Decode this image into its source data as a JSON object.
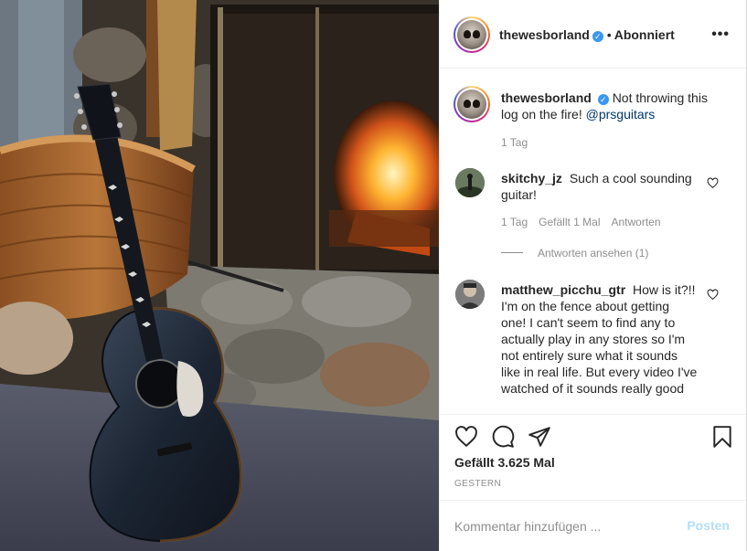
{
  "post": {
    "author": "thewesborland",
    "follow_status": "Abonniert",
    "separator": "•",
    "more_glyph": "•••",
    "verified_glyph": "✓"
  },
  "caption": {
    "username": "thewesborland",
    "text": "Not throwing this log on the fire!",
    "mention": "@prsguitars",
    "time": "1 Tag"
  },
  "comments": [
    {
      "username": "skitchy_jz",
      "text": "Such a cool sounding guitar!",
      "time": "1 Tag",
      "likes": "Gefällt 1 Mal",
      "reply": "Antworten",
      "view_replies": "Antworten ansehen (1)"
    },
    {
      "username": "matthew_picchu_gtr",
      "text": "How is it?!! I'm on the fence about getting one! I can't seem to find any to actually play in any stores so I'm not entirely sure what it sounds like in real life. But every video I've watched of it sounds really good"
    }
  ],
  "actions": {
    "icons": [
      "heart-icon",
      "comment-icon",
      "share-icon",
      "bookmark-icon"
    ]
  },
  "likes": "Gefällt 3.625 Mal",
  "date": "GESTERN",
  "add_comment": {
    "placeholder": "Kommentar hinzufügen ...",
    "post_label": "Posten"
  },
  "colors": {
    "accent_disabled": "#b2dffc",
    "verified": "#3897f0",
    "mention": "#00376b",
    "muted": "#8e8e8e"
  }
}
